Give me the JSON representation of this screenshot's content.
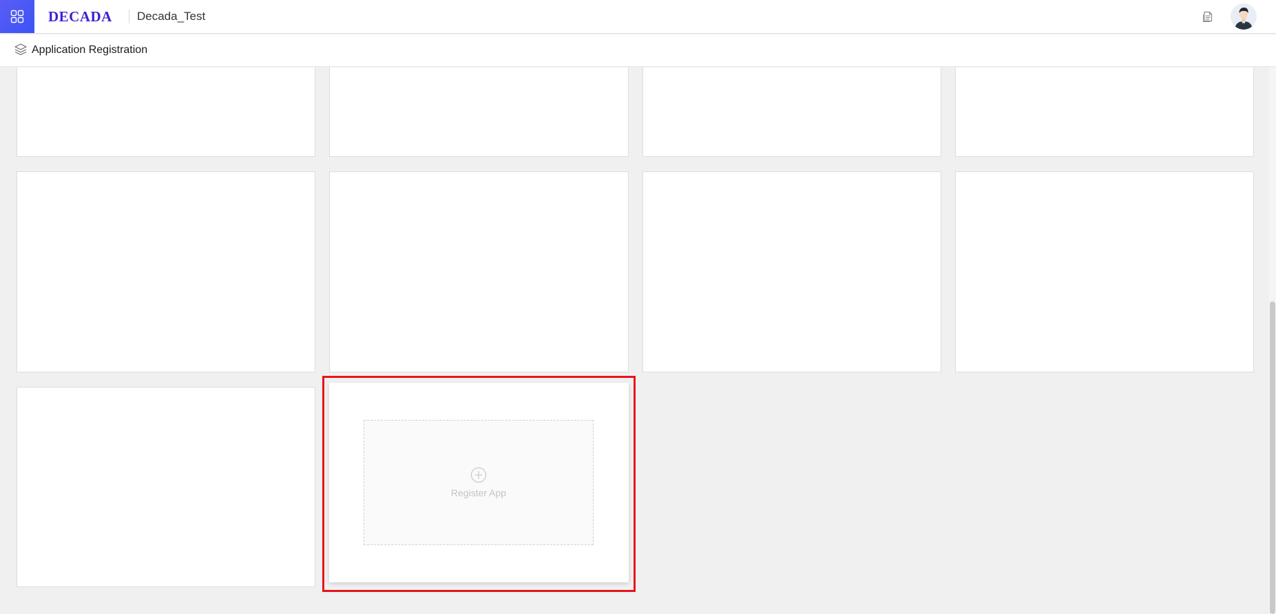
{
  "topbar": {
    "logo_text": "DECADA",
    "org_name": "Decada_Test",
    "apps_icon": "app-grid-icon",
    "doc_icon": "document-icon",
    "avatar_icon": "user-avatar-icon"
  },
  "subheader": {
    "icon": "layers-icon",
    "title": "Application Registration"
  },
  "cards": {
    "count": 9,
    "register": {
      "icon": "plus-circle-icon",
      "label": "Register App"
    }
  },
  "colors": {
    "brand": "#3d1fd4",
    "apps_button": "#4a57f5",
    "highlight": "#e8141b",
    "background": "#f0f0f0"
  }
}
